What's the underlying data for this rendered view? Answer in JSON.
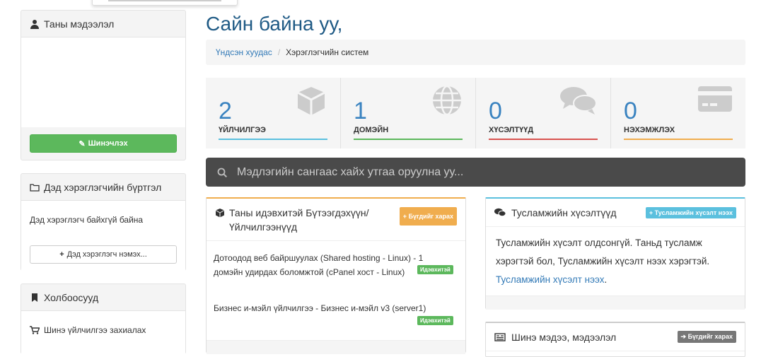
{
  "sidebar": {
    "profile": {
      "title": "Таны мэдээлэл",
      "update_button": "Шинэчлэх"
    },
    "subusers": {
      "title": "Дэд хэрэглэгчийн бүртгэл",
      "empty_text": "Дэд хэрэглэгч байхгүй байна",
      "add_button": "Дэд хэрэглэгч нэмэх..."
    },
    "links": {
      "title": "Холбоосууд",
      "items": [
        "Шинэ үйлчилгээ захиалах"
      ]
    }
  },
  "main": {
    "greeting": "Сайн байна уу,",
    "breadcrumb": {
      "home": "Үндсэн хуудас",
      "current": "Хэрэглэгчийн систем"
    },
    "stats": [
      {
        "value": "2",
        "label": "ҮЙЛЧИЛГЭЭ",
        "color": "#5bc0de",
        "icon": "cube-icon"
      },
      {
        "value": "1",
        "label": "ДОМЭЙН",
        "color": "#5cb85c",
        "icon": "globe-icon"
      },
      {
        "value": "0",
        "label": "ХҮСЭЛТҮҮД",
        "color": "#d9534f",
        "icon": "comments-icon"
      },
      {
        "value": "0",
        "label": "НЭХЭМЖЛЭХ",
        "color": "#f0ad4e",
        "icon": "credit-card-icon"
      }
    ],
    "search": {
      "placeholder": "Мэдлэгийн сангаас хайх утгаа оруулна уу..."
    },
    "services": {
      "title": "Таны идэвхитэй Бүтээгдэхүүн/ Үйлчилгээнүүд",
      "view_all": "Бүгдийг харах",
      "items": [
        {
          "name": "Дотоодод веб байршуулах (Shared hosting - Linux) - 1 домэйн удирдах боломжтой (cPanel хост - Linux)",
          "status": "Идэвхитэй"
        },
        {
          "name": "Бизнес и-мэйл үйлчилгээ - Бизнес и-мэйл v3 (server1)",
          "status": "Идэвхитэй"
        }
      ]
    },
    "support": {
      "title": "Тусламжийн хүсэлтүүд",
      "new_button": "Тусламжийн хүсэлт нээх",
      "message": "Тусламжийн хүсэлт олдсонгүй. Таньд тусламж хэрэгтэй бол, Тусламжийн хүсэлт нээх хэрэгтэй.",
      "link": "Тусламжийн хүсэлт нээх"
    },
    "news": {
      "title": "Шинэ мэдээ, мэдээлэл",
      "view_all": "Бүгдийг харах"
    }
  },
  "colors": {
    "accent": "#337ab7",
    "green": "#5cb85c",
    "orange": "#f0ad4e",
    "info": "#5bc0de",
    "dark_search": "#4a4a4a"
  }
}
